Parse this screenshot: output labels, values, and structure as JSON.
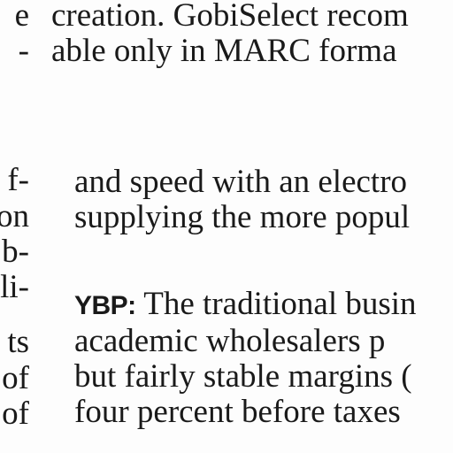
{
  "top_column": {
    "lines": [
      "creation. GobiSelect recom",
      "able only in MARC forma"
    ]
  },
  "left_column": {
    "lines": [
      "e",
      "-",
      "f-",
      "on",
      "b-",
      "li-",
      "ts",
      "of",
      "of"
    ]
  },
  "right_column": {
    "paragraph1": [
      "and speed with an electro",
      "supplying the more popul"
    ],
    "paragraph2": {
      "runin": "YBP:",
      "first_line_rest": " The traditional busin",
      "lines": [
        "academic wholesalers p",
        "but fairly stable margins (",
        "four percent before taxes"
      ]
    }
  }
}
